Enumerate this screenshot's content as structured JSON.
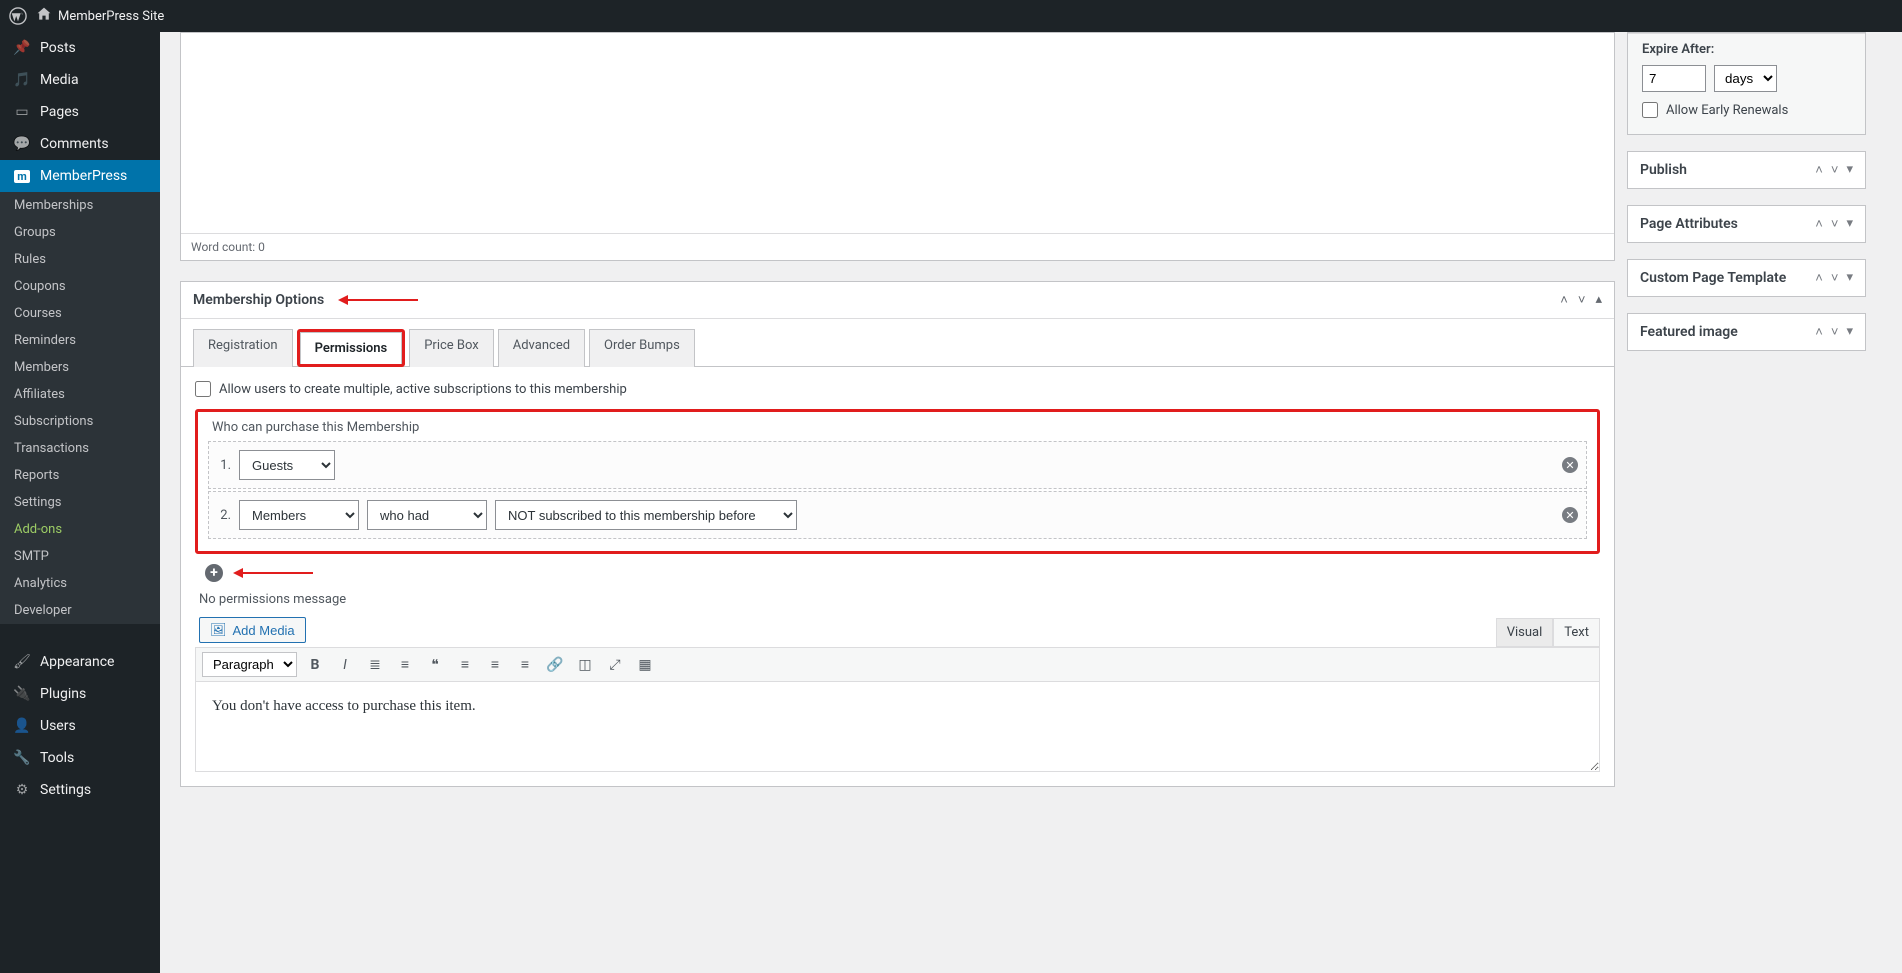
{
  "adminbar": {
    "site_name": "MemberPress Site"
  },
  "menu": {
    "posts": "Posts",
    "media": "Media",
    "pages": "Pages",
    "comments": "Comments",
    "memberpress": "MemberPress",
    "sub": {
      "memberships": "Memberships",
      "groups": "Groups",
      "rules": "Rules",
      "coupons": "Coupons",
      "courses": "Courses",
      "reminders": "Reminders",
      "members": "Members",
      "affiliates": "Affiliates",
      "subscriptions": "Subscriptions",
      "transactions": "Transactions",
      "reports": "Reports",
      "settings": "Settings",
      "addons": "Add-ons",
      "smtp": "SMTP",
      "analytics": "Analytics",
      "developer": "Developer"
    },
    "appearance": "Appearance",
    "plugins": "Plugins",
    "users": "Users",
    "tools": "Tools",
    "wp_settings": "Settings"
  },
  "editor": {
    "word_count_label": "Word count: 0"
  },
  "metabox": {
    "title": "Membership Options",
    "tabs": {
      "registration": "Registration",
      "permissions": "Permissions",
      "price_box": "Price Box",
      "advanced": "Advanced",
      "order_bumps": "Order Bumps"
    },
    "multi_sub_label": "Allow users to create multiple, active subscriptions to this membership",
    "who_label": "Who can purchase this Membership",
    "rows": [
      {
        "num": "1.",
        "who": "Guests"
      },
      {
        "num": "2.",
        "who": "Members",
        "cond": "who had",
        "detail": "NOT subscribed to this membership before"
      }
    ],
    "no_perm_label": "No permissions message",
    "add_media": "Add Media",
    "tm_tabs": {
      "visual": "Visual",
      "text": "Text"
    },
    "paragraph": "Paragraph",
    "content": "You don't have access to purchase this item."
  },
  "sidebar": {
    "expire": {
      "label": "Expire After:",
      "value": "7",
      "unit": "days",
      "early": "Allow Early Renewals"
    },
    "panels": {
      "publish": "Publish",
      "page_attributes": "Page Attributes",
      "custom_template": "Custom Page Template",
      "featured_image": "Featured image"
    }
  }
}
